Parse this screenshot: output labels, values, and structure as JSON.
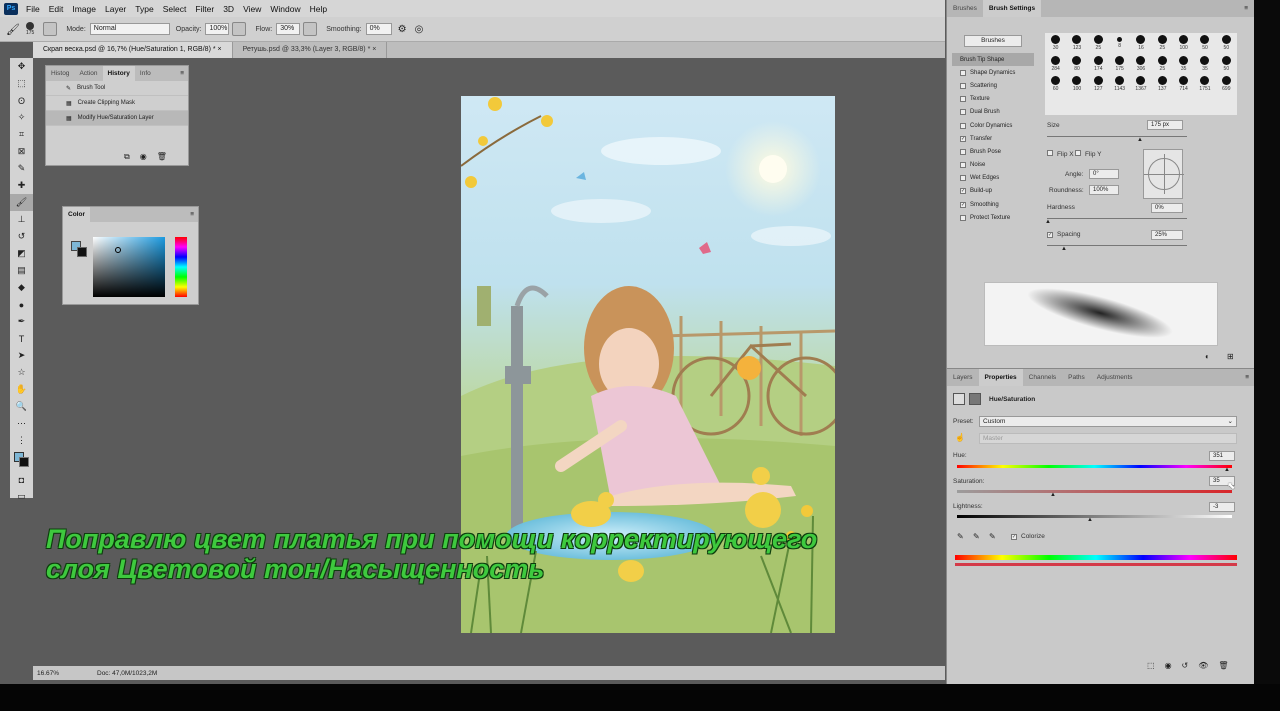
{
  "menu": {
    "logo": "Ps",
    "items": [
      "File",
      "Edit",
      "Image",
      "Layer",
      "Type",
      "Select",
      "Filter",
      "3D",
      "View",
      "Window",
      "Help"
    ]
  },
  "options": {
    "brush_size": "175",
    "mode_label": "Mode:",
    "mode_value": "Normal",
    "opacity_label": "Opacity:",
    "opacity_value": "100%",
    "flow_label": "Flow:",
    "flow_value": "30%",
    "smoothing_label": "Smoothing:",
    "smoothing_value": "0%"
  },
  "doc_tabs": [
    "Скрап веска.psd @ 16,7% (Hue/Saturation 1, RGB/8) *",
    "Ретушь.psd @ 33,3% (Layer 3, RGB/8) *"
  ],
  "history": {
    "tabs": [
      "Histog",
      "Action",
      "History",
      "Info"
    ],
    "rows": [
      "Brush Tool",
      "Create Clipping Mask",
      "Modify Hue/Saturation Layer"
    ]
  },
  "color_panel": {
    "title": "Color"
  },
  "caption": {
    "line1": "Поправлю цвет платья при помощи корректирующего",
    "line2": "слоя Цветовой тон/Насыщенность"
  },
  "status": {
    "zoom": "16.67%",
    "doc": "Doc: 47,0M/1023,2M"
  },
  "brush_settings": {
    "tabs": [
      "Brushes",
      "Brush Settings"
    ],
    "brushes_btn": "Brushes",
    "items": [
      "Brush Tip Shape",
      "Shape Dynamics",
      "Scattering",
      "Texture",
      "Dual Brush",
      "Color Dynamics",
      "Transfer",
      "Brush Pose",
      "Noise",
      "Wet Edges",
      "Build-up",
      "Smoothing",
      "Protect Texture"
    ],
    "tip_sizes": [
      "30",
      "123",
      "25",
      "8",
      "16",
      "25",
      "100",
      "50",
      "50",
      "284",
      "80",
      "174",
      "175",
      "306",
      "25",
      "35",
      "35",
      "50",
      "60",
      "100",
      "127",
      "1143",
      "1367",
      "137",
      "714",
      "1751",
      "699"
    ],
    "size_label": "Size",
    "size_value": "175 px",
    "flipx": "Flip X",
    "flipy": "Flip Y",
    "angle_label": "Angle:",
    "angle_value": "0°",
    "roundness_label": "Roundness:",
    "roundness_value": "100%",
    "hardness_label": "Hardness",
    "hardness_value": "0%",
    "spacing_label": "Spacing",
    "spacing_value": "25%"
  },
  "properties": {
    "tabs": [
      "Layers",
      "Properties",
      "Channels",
      "Paths",
      "Adjustments"
    ],
    "title": "Hue/Saturation",
    "preset_label": "Preset:",
    "preset_value": "Custom",
    "channel_value": "Master",
    "hue_label": "Hue:",
    "hue_value": "351",
    "sat_label": "Saturation:",
    "sat_value": "35",
    "light_label": "Lightness:",
    "light_value": "-3",
    "colorize_label": "Colorize"
  }
}
